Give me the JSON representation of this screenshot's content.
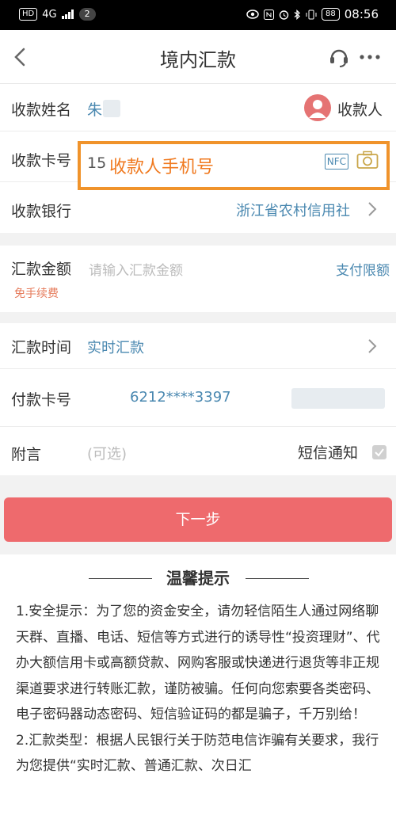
{
  "status_bar": {
    "hd": "HD",
    "network": "4G",
    "sim_badge": "2",
    "battery": "88",
    "time": "08:56"
  },
  "nav": {
    "title": "境内汇款"
  },
  "payee": {
    "name_label": "收款姓名",
    "name_value": "朱",
    "payee_button": "收款人",
    "card_label": "收款卡号",
    "card_value_prefix": "15",
    "card_overlay_text": "收款人手机号",
    "nfc_label": "NFC",
    "bank_label": "收款银行",
    "bank_value": "浙江省农村信用社"
  },
  "amount": {
    "label": "汇款金额",
    "placeholder": "请输入汇款金额",
    "limit_link": "支付限额",
    "fee_note": "免手续费"
  },
  "time": {
    "label": "汇款时间",
    "value": "实时汇款"
  },
  "payer": {
    "label": "付款卡号",
    "value": "6212****3397"
  },
  "note": {
    "label": "附言",
    "placeholder": "(可选)",
    "sms_label": "短信通知"
  },
  "next_button": "下一步",
  "tips": {
    "title": "温馨提示",
    "p1": "1.安全提示：为了您的资金安全，请勿轻信陌生人通过网络聊天群、直播、电话、短信等方式进行的诱导性“投资理财”、代办大额信用卡或高额贷款、网购客服或快递进行退货等非正规渠道要求进行转账汇款，谨防被骗。任何向您索要各类密码、电子密码器动态密码、短信验证码的都是骗子，千万别给！",
    "p2": "2.汇款类型：根据人民银行关于防范电信诈骗有关要求，我行为您提供“实时汇款、普通汇款、次日汇"
  },
  "colors": {
    "accent_blue": "#4a88b0",
    "highlight_orange": "#f0932b",
    "button_red": "#ee6a6d"
  }
}
